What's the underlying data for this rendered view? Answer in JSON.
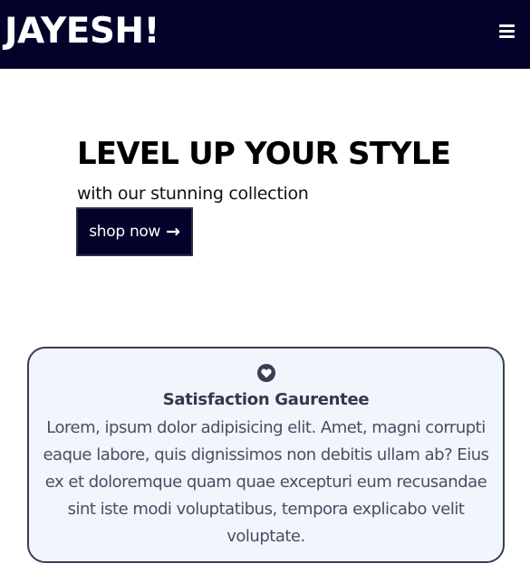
{
  "navbar": {
    "logo": "JAYESH!",
    "menu_icon": "hamburger-menu-icon",
    "background_color": "#02022a"
  },
  "hero": {
    "title": "LEVEL UP YOUR STYLE",
    "subtitle": "with our stunning collection",
    "button_label": "shop now",
    "button_icon": "arrow-right-icon"
  },
  "feature_card": {
    "icon": "heart-icon",
    "title": "Satisfaction Gaurentee",
    "text": "Lorem, ipsum dolor adipisicing elit. Amet, magni corrupti eaque labore, quis dignissimos non debitis ullam ab? Eius ex et doloremque quam quae excepturi eum recusandae sint iste modi voluptatibus, tempora explicabo velit voluptate.",
    "background_color": "#f1f5fc",
    "border_color": "#3a3d55"
  }
}
